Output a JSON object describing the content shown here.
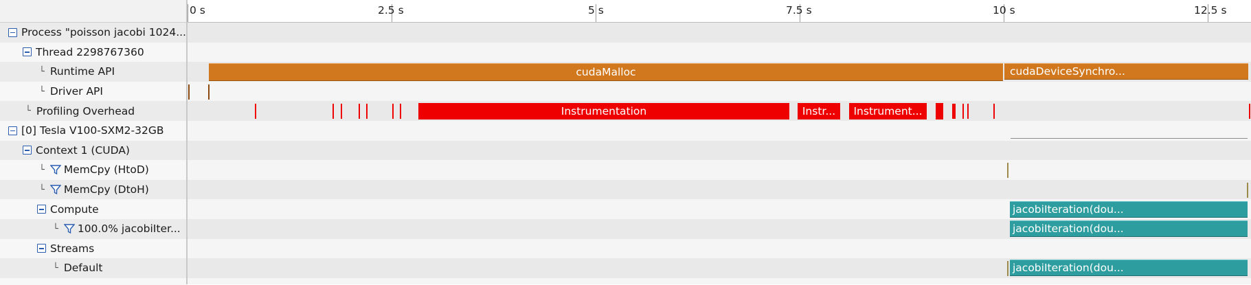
{
  "ruler": {
    "ticks": [
      "0 s",
      "2.5 s",
      "5 s",
      "7.5 s",
      "10 s",
      "12.5 s"
    ]
  },
  "tree": {
    "process": "Process \"poisson jacobi 1024...",
    "thread": "Thread 2298767360",
    "runtime_api": "Runtime API",
    "driver_api": "Driver API",
    "profiling_overhead": "Profiling Overhead",
    "device": "[0] Tesla V100-SXM2-32GB",
    "context": "Context 1 (CUDA)",
    "memcpy_htod": "MemCpy (HtoD)",
    "memcpy_dtoh": "MemCpy (DtoH)",
    "compute": "Compute",
    "kernel_share": "100.0% jacobiIter...",
    "streams": "Streams",
    "default_stream": "Default"
  },
  "timeline": {
    "runtime_bar_1": "cudaMalloc",
    "runtime_bar_2": "cudaDeviceSynchro...",
    "overhead_bar_1": "Instrumentation",
    "overhead_bar_2": "Instr...",
    "overhead_bar_3": "Instrument...",
    "compute_kernel": "jacobiIteration(dou...",
    "kernel_row": "jacobiIteration(dou...",
    "default_kernel": "jacobiIteration(dou..."
  },
  "colors": {
    "runtime": "#d1781e",
    "overhead": "#ee0000",
    "kernel": "#2e9d9f",
    "toggle": "#2a5db0"
  }
}
